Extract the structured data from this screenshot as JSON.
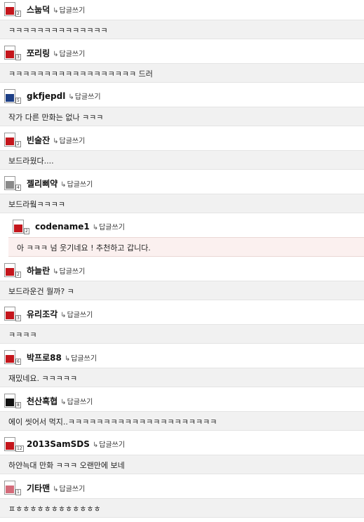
{
  "reply_label": "답글쓰기",
  "reply_arrow": "↳",
  "comments": [
    {
      "nick": "스눕덕",
      "level": "2",
      "avatar": "hwatu-red-card",
      "text": "ㅋㅋㅋㅋㅋㅋㅋㅋㅋㅋㅋㅋㅋㅋ",
      "reply": false
    },
    {
      "nick": "쪼리링",
      "level": "3",
      "avatar": "hwatu-red-card",
      "text": "ㅋㅋㅋㅋㅋㅋㅋㅋㅋㅋㅋㅋㅋㅋㅋㅋㅋㅋ 드러",
      "reply": false
    },
    {
      "nick": "gkfjepdl",
      "level": "5",
      "avatar": "hwatu-blue-card",
      "text": "작가 다른 만화는 없나 ㅋㅋㅋ",
      "reply": false
    },
    {
      "nick": "빈술잔",
      "level": "2",
      "avatar": "hwatu-red-card",
      "text": "보드라웠다....",
      "reply": false
    },
    {
      "nick": "젤리삐약",
      "level": "4",
      "avatar": "hwatu-gray-card",
      "text": "보드라웤ㅋㅋㅋㅋ",
      "reply": false
    },
    {
      "nick": "codename1",
      "level": "2",
      "avatar": "hwatu-red-card",
      "text": "아 ㅋㅋㅋ 넘 웃기네요 ! 추천하고 갑니다.",
      "reply": true
    },
    {
      "nick": "하늘란",
      "level": "2",
      "avatar": "hwatu-red-card",
      "text": "보드라운건 뭘까? ㅋ",
      "reply": false
    },
    {
      "nick": "유리조각",
      "level": "3",
      "avatar": "hwatu-red-card",
      "text": "ㅋㅋㅋㅋ",
      "reply": false
    },
    {
      "nick": "박프로88",
      "level": "6",
      "avatar": "hwatu-red-card",
      "text": "재밌네요. ㅋㅋㅋㅋㅋ",
      "reply": false
    },
    {
      "nick": "천산흑협",
      "level": "8",
      "avatar": "hwatu-black-card",
      "text": "에이 씻어서 먹지..ㅋㅋㅋㅋㅋㅋㅋㅋㅋㅋㅋㅋㅋㅋㅋㅋㅋㅋㅋㅋㅋ",
      "reply": false
    },
    {
      "nick": "2013SamSDS",
      "level": "12",
      "avatar": "hwatu-red-card",
      "text": "하얀늑대 만화 ㅋㅋㅋ 오랜만에 보네",
      "reply": false
    },
    {
      "nick": "기타맨",
      "level": "1",
      "avatar": "hwatu-pink-card",
      "text": "ㅍㅎㅎㅎㅎㅎㅎㅎㅎㅎㅎㅎㅎ",
      "reply": false
    }
  ],
  "colors": {
    "hwatu-red-card": "#c4161c",
    "hwatu-blue-card": "#1d3f86",
    "hwatu-gray-card": "#8a8a8a",
    "hwatu-black-card": "#111111",
    "hwatu-pink-card": "#d46b7a"
  }
}
